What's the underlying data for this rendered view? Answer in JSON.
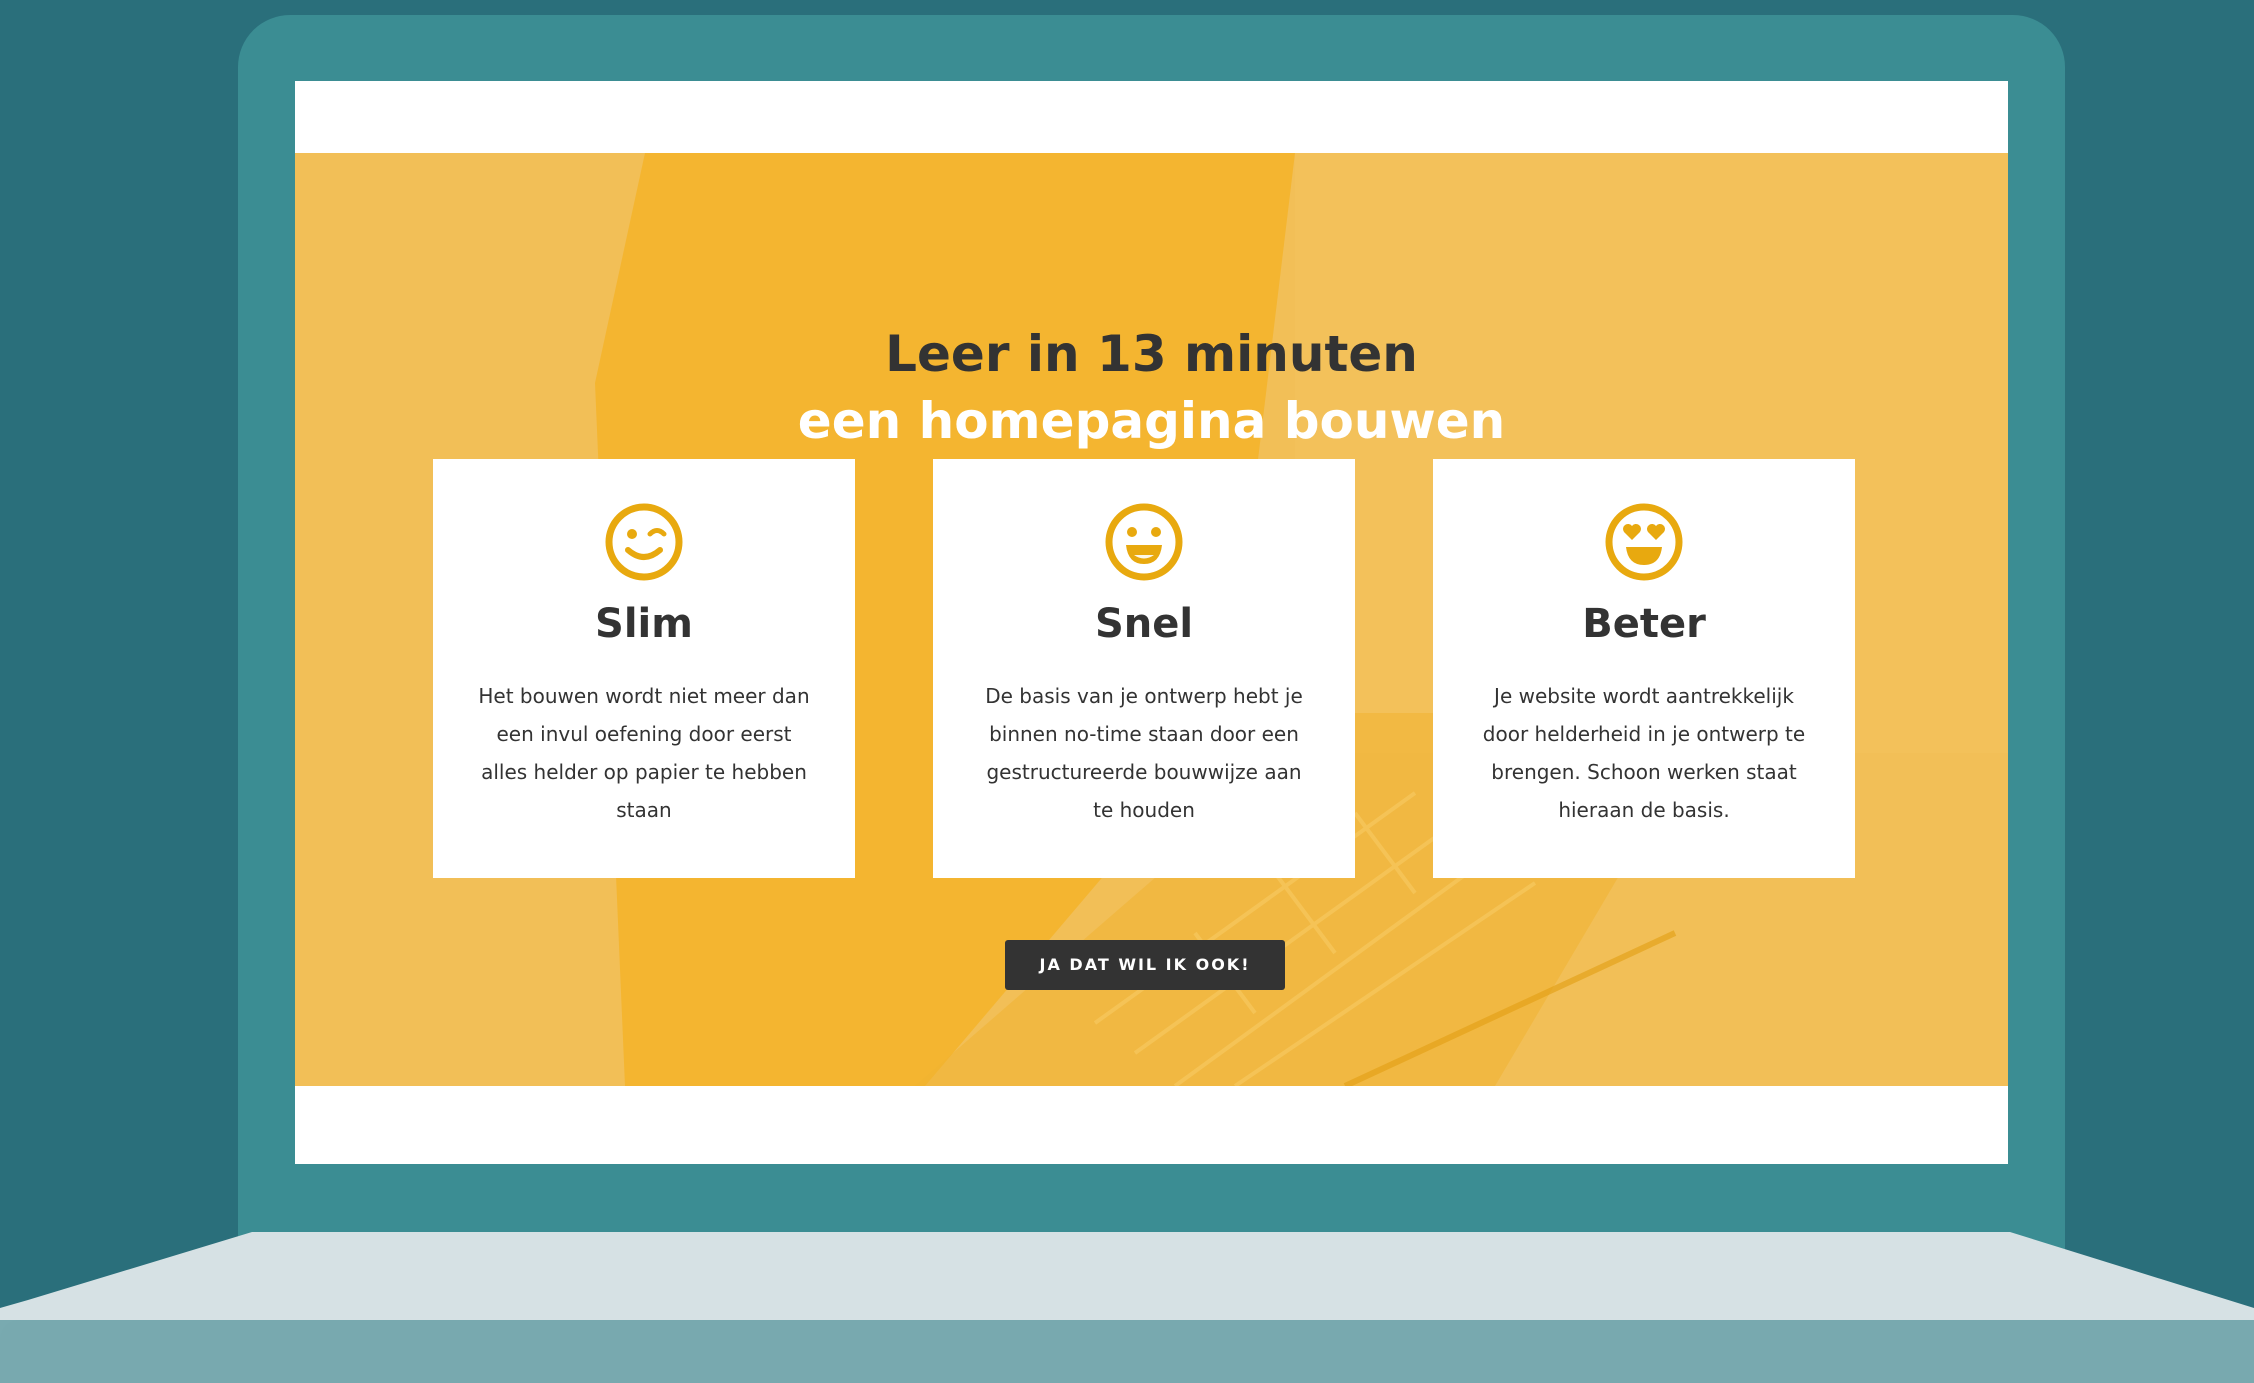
{
  "hero": {
    "headline_line1": "Leer in 13 minuten",
    "headline_line2": "een homepagina bouwen"
  },
  "cards": [
    {
      "title": "Slim",
      "text": "Het bouwen wordt niet meer dan een invul oefening door eerst alles helder op papier te hebben staan",
      "icon": "winking-face-icon"
    },
    {
      "title": "Snel",
      "text": "De basis van je ontwerp hebt je binnen no-time staan door een gestructureerde bouwwijze aan te houden",
      "icon": "grinning-face-icon"
    },
    {
      "title": "Beter",
      "text": "Je website wordt aantrekkelijk door helderheid in je ontwerp te brengen. Schoon werken staat hieraan de basis.",
      "icon": "heart-eyes-face-icon"
    }
  ],
  "cta": {
    "label": "JA DAT WIL IK OOK!"
  },
  "colors": {
    "background": "#2a6f7b",
    "laptop_frame": "#3b8d93",
    "hero": "#f2bf57",
    "accent": "#e8a90f",
    "text_dark": "#333333",
    "button": "#333333"
  }
}
